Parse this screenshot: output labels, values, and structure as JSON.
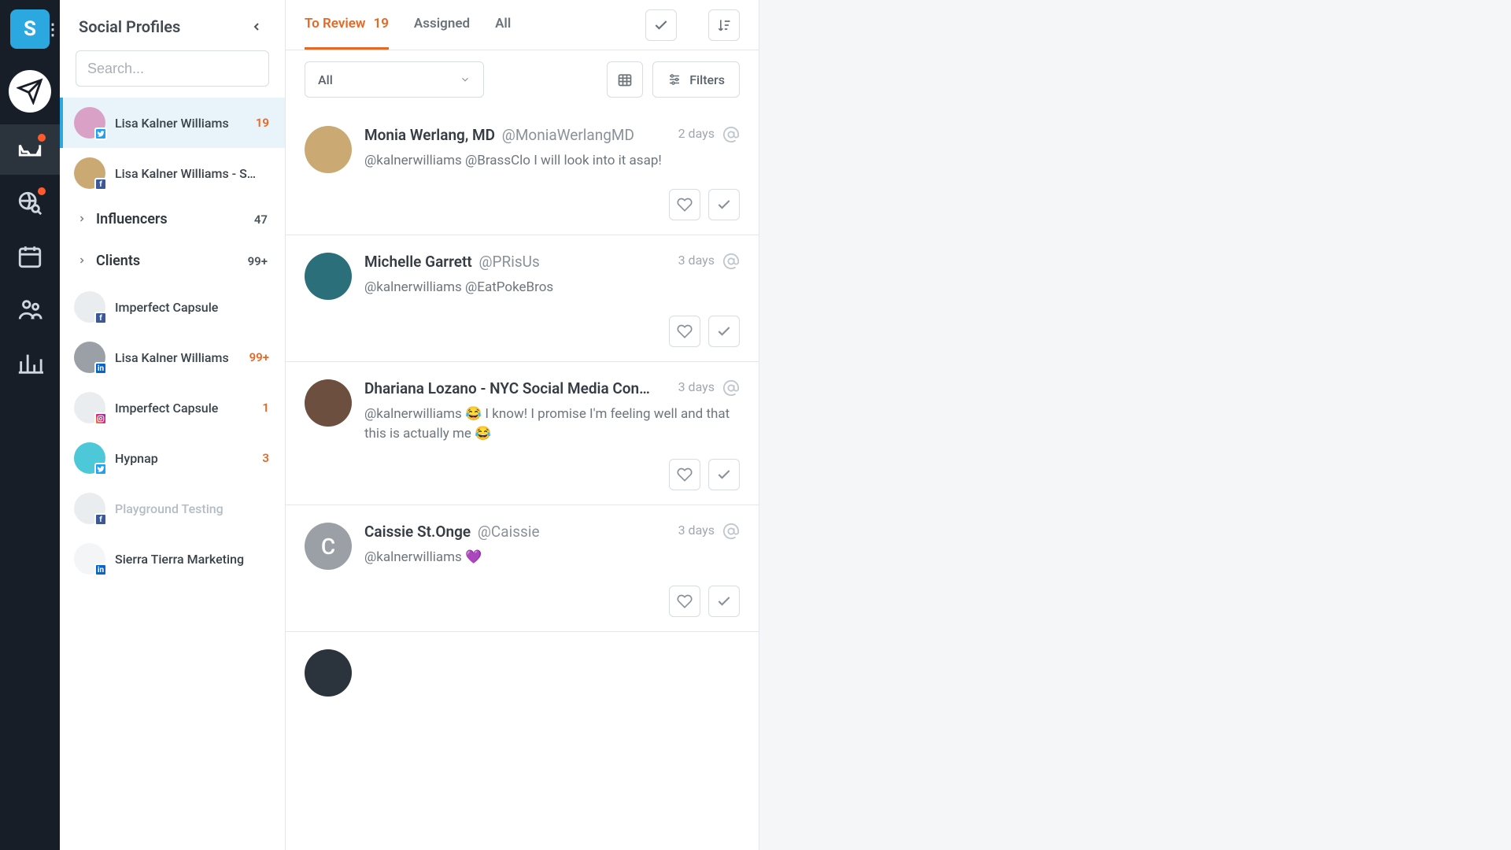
{
  "rail": {
    "logo_letter": "S"
  },
  "sidebar": {
    "title": "Social Profiles",
    "search_placeholder": "Search...",
    "profiles_top": [
      {
        "name": "Lisa Kalner Williams",
        "count": "19",
        "network": "tw",
        "active": true,
        "avatar": "pink"
      },
      {
        "name": "Lisa Kalner Williams - S…",
        "count": "",
        "network": "fb",
        "active": false,
        "avatar": "gold"
      }
    ],
    "groups": [
      {
        "name": "Influencers",
        "count": "47"
      },
      {
        "name": "Clients",
        "count": "99+"
      }
    ],
    "profiles_bottom": [
      {
        "name": "Imperfect Capsule",
        "count": "",
        "network": "fb",
        "avatar": "light"
      },
      {
        "name": "Lisa Kalner Williams",
        "count": "99+",
        "network": "li",
        "avatar": "gray"
      },
      {
        "name": "Imperfect Capsule",
        "count": "1",
        "network": "ig",
        "avatar": "light"
      },
      {
        "name": "Hypnap",
        "count": "3",
        "network": "tw",
        "avatar": "cyan"
      },
      {
        "name": "Playground Testing",
        "count": "",
        "network": "fb",
        "avatar": "light",
        "muted": true
      },
      {
        "name": "Sierra Tierra Marketing",
        "count": "",
        "network": "li",
        "avatar": "white"
      }
    ]
  },
  "tabs": {
    "to_review": "To Review",
    "to_review_count": "19",
    "assigned": "Assigned",
    "all": "All"
  },
  "toolbar": {
    "dropdown_label": "All",
    "filters_label": "Filters"
  },
  "messages": [
    {
      "name": "Monia Werlang, MD",
      "handle": "@MoniaWerlangMD",
      "time": "2 days",
      "text": "@kalnerwilliams @BrassClo I will look into it asap!",
      "avatar": "gold",
      "initial": ""
    },
    {
      "name": "Michelle Garrett",
      "handle": "@PRisUs",
      "time": "3 days",
      "text": "@kalnerwilliams @EatPokeBros",
      "avatar": "teal",
      "initial": ""
    },
    {
      "name": "Dhariana Lozano - NYC Social Media Con…",
      "handle": "",
      "time": "3 days",
      "text": "@kalnerwilliams 😂 I know! I promise I'm feeling well and that this is actually me 😂",
      "avatar": "brown",
      "initial": ""
    },
    {
      "name": "Caissie St.Onge",
      "handle": "@Caissie",
      "time": "3 days",
      "text": "@kalnerwilliams 💜",
      "avatar": "gray",
      "initial": "C"
    }
  ]
}
